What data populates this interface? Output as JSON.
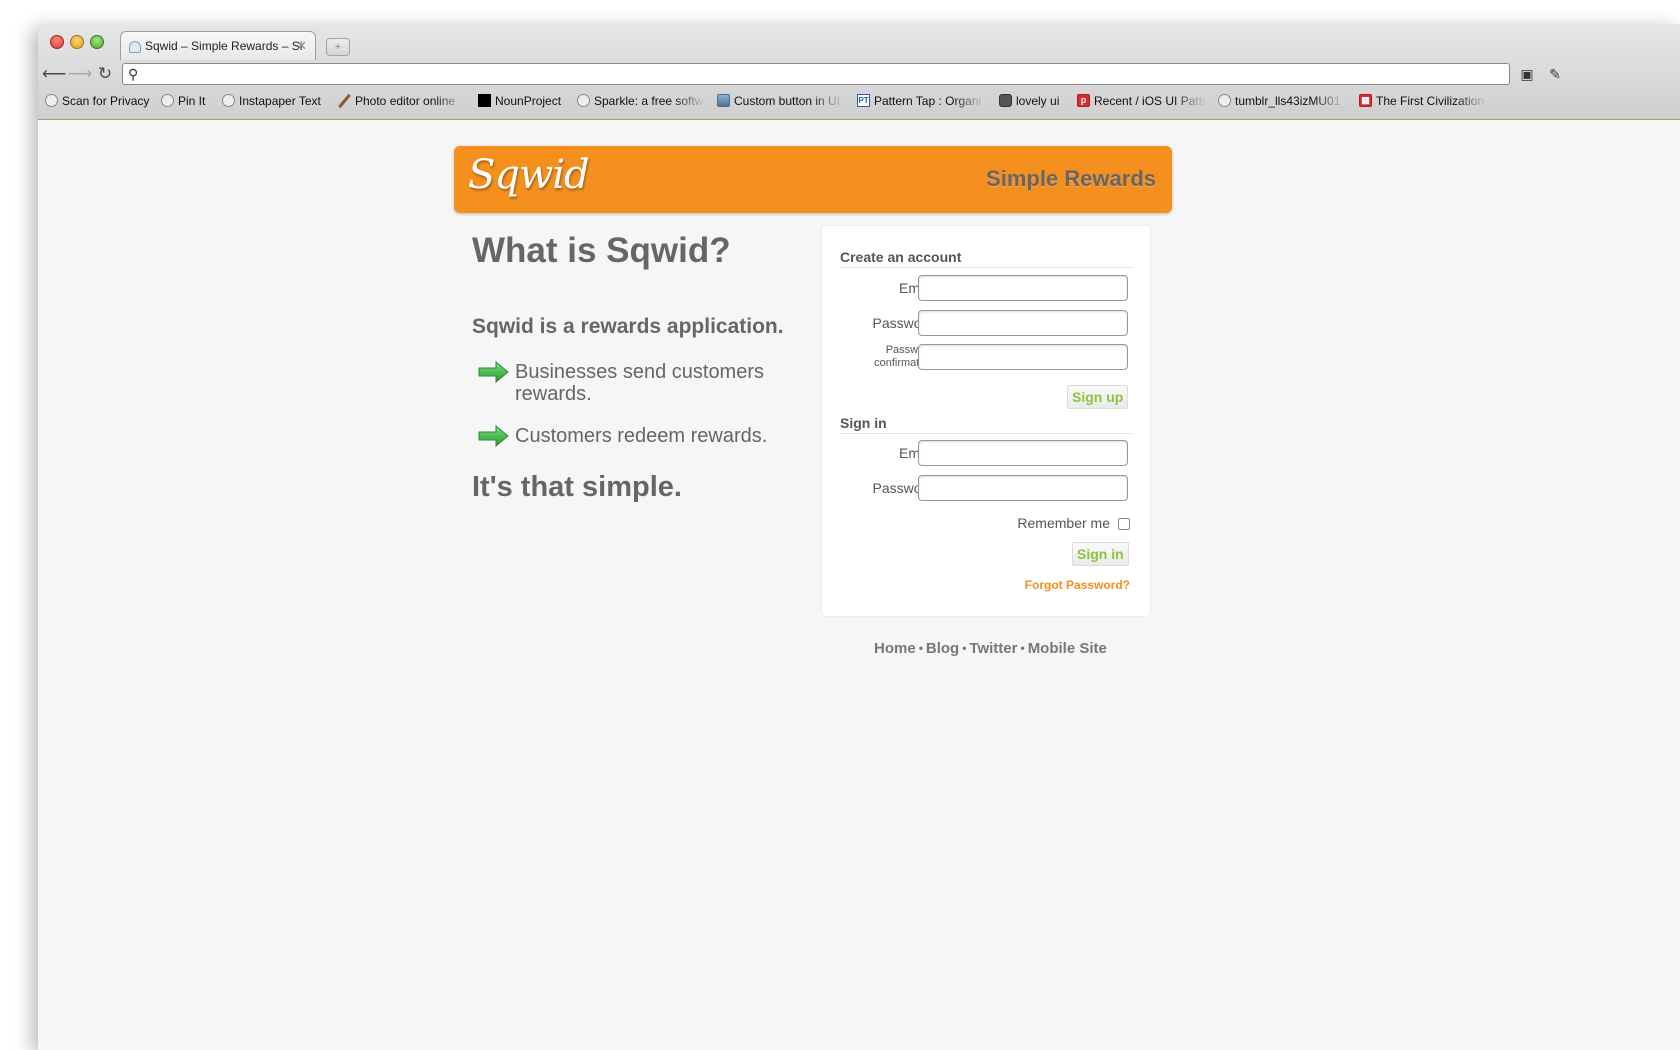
{
  "browser": {
    "tab_title": "Sqwid – Simple Rewards – Si",
    "new_tab_label": "+",
    "url": "",
    "bookmarks": [
      {
        "label": "Scan for Privacy",
        "icon": "globe-icon"
      },
      {
        "label": "Pin It",
        "icon": "globe-icon"
      },
      {
        "label": "Instapaper Text",
        "icon": "globe-icon"
      },
      {
        "label": "Photo editor online",
        "icon": "pencil-icon"
      },
      {
        "label": "NounProject",
        "icon": "black-square-icon"
      },
      {
        "label": "Sparkle: a free softw",
        "icon": "globe-icon"
      },
      {
        "label": "Custom button in UI",
        "icon": "image-icon"
      },
      {
        "label": "Pattern Tap : Organi",
        "icon": "pattern-tap-icon"
      },
      {
        "label": "lovely ui",
        "icon": "shield-icon"
      },
      {
        "label": "Recent / iOS UI Patte",
        "icon": "pinterest-icon"
      },
      {
        "label": "tumblr_lls43izMU01",
        "icon": "globe-icon"
      },
      {
        "label": "The First Civilization",
        "icon": "red-grid-icon"
      }
    ]
  },
  "header": {
    "logo": "Sqwid",
    "tagline": "Simple Rewards"
  },
  "intro": {
    "title": "What is Sqwid?",
    "subtitle": "Sqwid is a rewards application.",
    "bullets": [
      "Businesses send customers rewards.",
      "Customers redeem rewards."
    ],
    "closing": "It's that simple."
  },
  "signup": {
    "title": "Create an account",
    "email_label": "Email",
    "password_label": "Password",
    "confirm_label": "Password confirmation",
    "button": "Sign up"
  },
  "signin": {
    "title": "Sign in",
    "email_label": "Email",
    "password_label": "Password",
    "remember_label": "Remember me",
    "button": "Sign in",
    "forgot": "Forgot Password?"
  },
  "footer": {
    "links": [
      "Home",
      "Blog",
      "Twitter",
      "Mobile Site"
    ],
    "separator": "•"
  },
  "colors": {
    "brand_orange": "#f58f1e",
    "button_green": "#8ac53c",
    "text_gray": "#666666"
  }
}
